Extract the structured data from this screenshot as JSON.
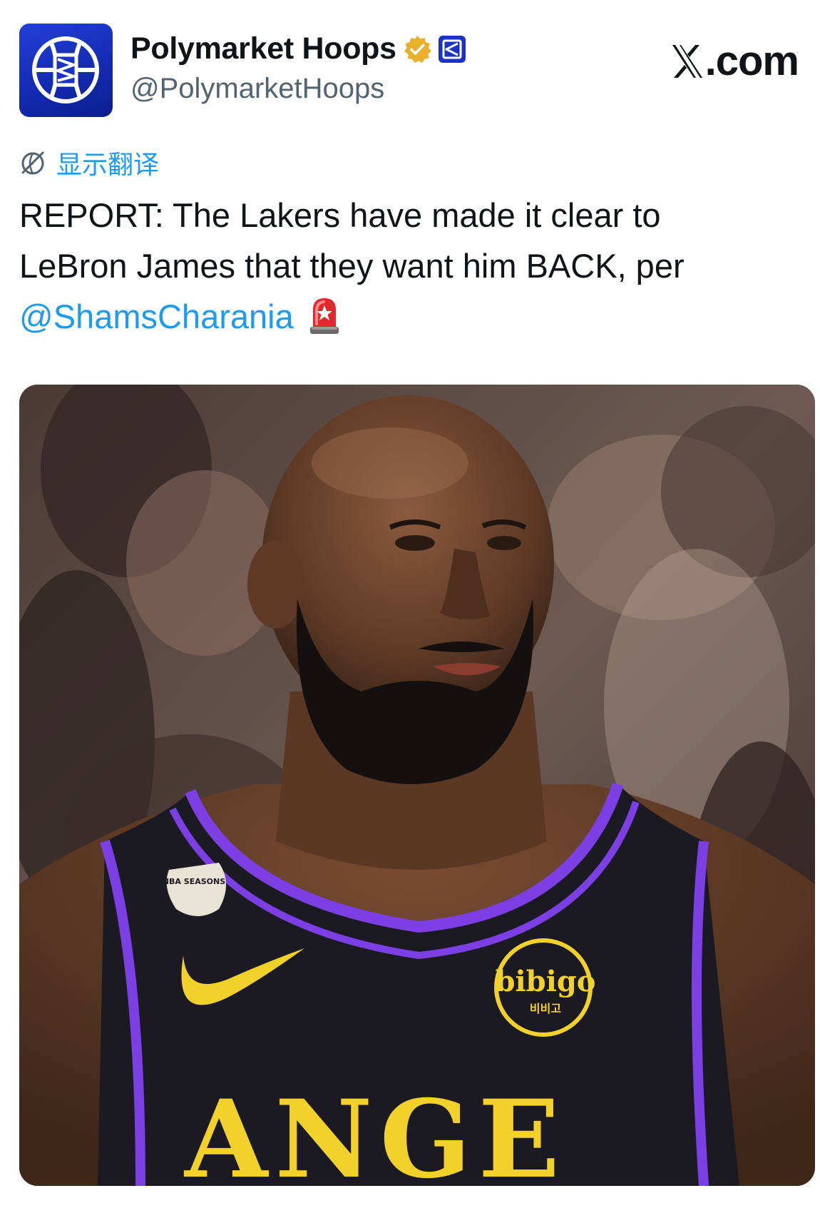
{
  "account": {
    "display_name": "Polymarket Hoops",
    "handle": "@PolymarketHoops",
    "avatar_icon": "basketball-logo-icon",
    "verified_icon": "verified-badge-icon",
    "affiliate_icon": "polymarket-affiliate-icon"
  },
  "source": {
    "label_rest": ".com"
  },
  "translate": {
    "label": "显示翻译",
    "icon": "globe-icon"
  },
  "tweet": {
    "line1": "REPORT: The Lakers have made it clear to",
    "line2": "LeBron James that they want him BACK, per",
    "mention": "@ShamsCharania",
    "emoji": "siren-icon"
  },
  "media": {
    "jersey_sponsor": "bibigo",
    "jersey_sponsor_sub": "비비고",
    "jersey_letters": "ANGE",
    "patch_text": "NBA SEASONS"
  },
  "colors": {
    "link": "#1d9bf0",
    "avatar_blue": "#1a33c4",
    "verified_gold": "#e8b02d",
    "jersey": "#1b1a22",
    "jersey_trim": "#7b3fe4",
    "jersey_gold": "#f2d12b"
  }
}
